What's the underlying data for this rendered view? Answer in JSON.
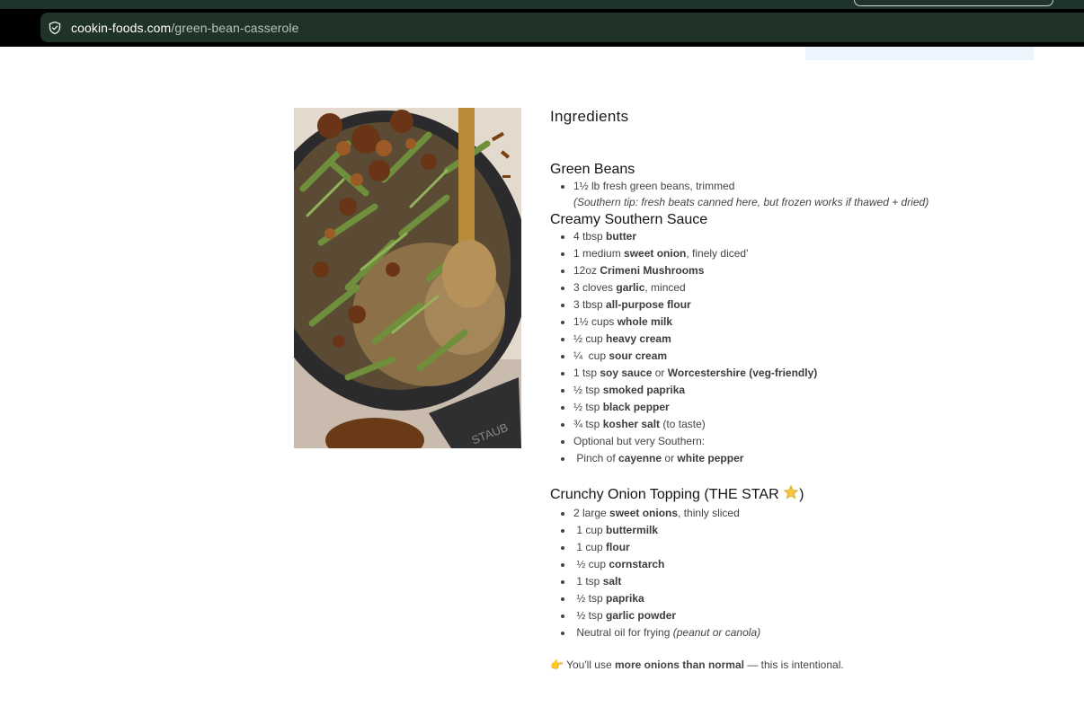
{
  "browser": {
    "url_host": "cookin-foods.com",
    "url_path": "/green-bean-casserole"
  },
  "image": {
    "alt": "Green bean casserole in a cast iron dish",
    "brand_mark": "STAUB"
  },
  "ingredients_heading": "Ingredients",
  "green_beans": {
    "title": "Green Beans",
    "item1": "1½ lb fresh green beans, trimmed",
    "tip": "(Southern tip: fresh beats canned here, but frozen works if thawed + dried)"
  },
  "sauce": {
    "title": "Creamy Southern Sauce",
    "i1": {
      "a": "4 tbsp ",
      "b": "butter"
    },
    "i2": {
      "a": "1 medium ",
      "b": "sweet onion",
      "c": ", finely diced'"
    },
    "i3": {
      "a": "12oz ",
      "b": "Crimeni Mushrooms"
    },
    "i4": {
      "a": "3 cloves ",
      "b": "garlic",
      "c": ", minced"
    },
    "i5": {
      "a": "3 tbsp ",
      "b": "all-purpose flour"
    },
    "i6": {
      "a": "1½ cups ",
      "b": "whole milk"
    },
    "i7": {
      "a": "½ cup ",
      "b": "heavy cream"
    },
    "i8": {
      "a": "¼  cup ",
      "b": "sour cream"
    },
    "i9": {
      "a": "1 tsp ",
      "b": "soy sauce",
      "c": " or ",
      "d": "Worcestershire (veg-friendly)"
    },
    "i10": {
      "a": "½ tsp ",
      "b": "smoked paprika"
    },
    "i11": {
      "a": "½ tsp ",
      "b": "black pepper"
    },
    "i12": {
      "a": "¾ tsp ",
      "b": "kosher salt",
      "c": " (to taste)"
    },
    "i13": "Optional but very Southern:",
    "i14": {
      "a": " Pinch of ",
      "b": "cayenne",
      "c": " or ",
      "d": "white pepper"
    }
  },
  "topping": {
    "title": "Crunchy Onion Topping (THE STAR ",
    "title_end": ")",
    "i1": {
      "a": "2 large ",
      "b": "sweet onions",
      "c": ", thinly sliced"
    },
    "i2": {
      "a": " 1 cup ",
      "b": "buttermilk"
    },
    "i3": {
      "a": " 1 cup ",
      "b": "flour"
    },
    "i4": {
      "a": " ½ cup ",
      "b": "cornstarch"
    },
    "i5": {
      "a": " 1 tsp ",
      "b": "salt"
    },
    "i6": {
      "a": " ½ tsp ",
      "b": "paprika"
    },
    "i7": {
      "a": " ½ tsp ",
      "b": "garlic powder"
    },
    "i8": {
      "a": " Neutral oil for frying ",
      "b": "(peanut or canola)"
    }
  },
  "note": {
    "emoji": "👉",
    "a": " You'll use ",
    "b": "more onions than normal",
    "c": " — this is intentional."
  },
  "colors": {
    "chrome_dark": "#1e3329",
    "url_bar": "#1f3328",
    "star": "#f4c542"
  }
}
